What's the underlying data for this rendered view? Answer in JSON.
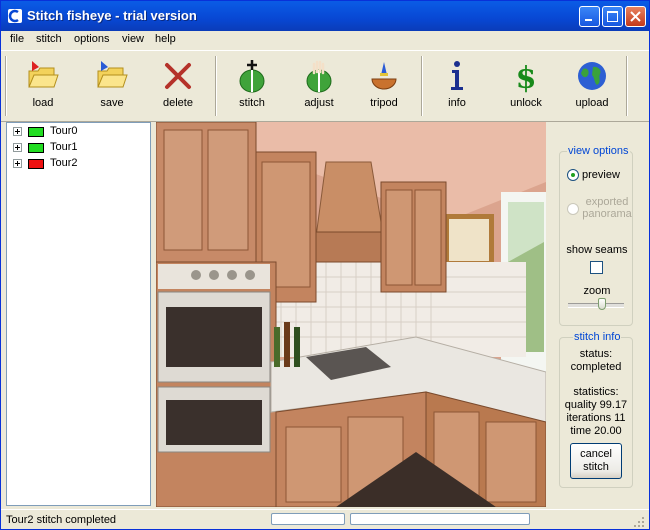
{
  "window": {
    "title": "Stitch fisheye - trial version"
  },
  "menu": [
    "file",
    "stitch",
    "options",
    "view",
    "help"
  ],
  "toolbar": {
    "tools": [
      {
        "label": "load",
        "icon": "folder-open-icon"
      },
      {
        "label": "save",
        "icon": "folder-save-icon"
      },
      {
        "label": "delete",
        "icon": "delete-x-icon"
      },
      {
        "label": "stitch",
        "icon": "stitch-icon"
      },
      {
        "label": "adjust",
        "icon": "adjust-hand-icon"
      },
      {
        "label": "tripod",
        "icon": "tripod-icon"
      },
      {
        "label": "info",
        "icon": "info-icon"
      },
      {
        "label": "unlock",
        "icon": "dollar-icon"
      },
      {
        "label": "upload",
        "icon": "globe-icon"
      }
    ]
  },
  "tree": {
    "items": [
      {
        "label": "Tour0",
        "color": "#22dd22"
      },
      {
        "label": "Tour1",
        "color": "#22dd22"
      },
      {
        "label": "Tour2",
        "color": "#ee1111"
      }
    ]
  },
  "view_options": {
    "title": "view options",
    "preview_label": "preview",
    "exported_label": "exported panorama",
    "preview_selected": true,
    "show_seams_label": "show seams",
    "show_seams_checked": false,
    "zoom_label": "zoom",
    "zoom_level": 0.6
  },
  "stitch_info": {
    "title": "stitch info",
    "status_label": "status:",
    "status_value": "completed",
    "statistics_label": "statistics:",
    "quality": "quality 99.17",
    "iterations": "iterations 11",
    "time": "time 20.00",
    "cancel_label": "cancel stitch"
  },
  "statusbar": {
    "text": "Tour2 stitch completed"
  }
}
